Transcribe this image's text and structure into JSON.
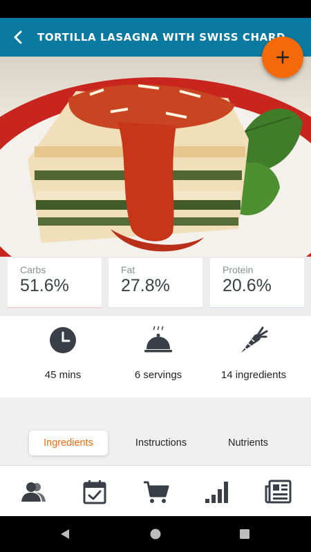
{
  "app_bar": {
    "title": "TORTILLA LASAGNA WITH SWISS CHARD",
    "back_icon": "chevron-left-icon",
    "color": "#0b7aa1"
  },
  "fab": {
    "icon": "plus-icon",
    "color": "#f46a0a"
  },
  "hero_image": {
    "subject": "lasagna-photo"
  },
  "macros": [
    {
      "label": "Carbs",
      "value": "51.6%",
      "color": "#f5c4bd"
    },
    {
      "label": "Fat",
      "value": "27.8%",
      "color": "#e6e6e6"
    },
    {
      "label": "Protein",
      "value": "20.6%",
      "color": "#cfe3f2"
    }
  ],
  "stats": {
    "time": {
      "text": "45 mins",
      "icon": "clock-icon"
    },
    "servings": {
      "text": "6 servings",
      "icon": "cloche-icon"
    },
    "ingredients": {
      "text": "14 ingredients",
      "icon": "carrot-icon"
    }
  },
  "tabs": {
    "ingredients": "Ingredients",
    "instructions": "Instructions",
    "nutrients": "Nutrients",
    "active": "Ingredients",
    "accent": "#f46a0a"
  },
  "bottom_nav": [
    {
      "icon": "profile-icon"
    },
    {
      "icon": "calendar-check-icon"
    },
    {
      "icon": "cart-icon"
    },
    {
      "icon": "bar-chart-icon"
    },
    {
      "icon": "newspaper-icon"
    }
  ],
  "system_nav": [
    "back-triangle-icon",
    "home-circle-icon",
    "recents-square-icon"
  ]
}
